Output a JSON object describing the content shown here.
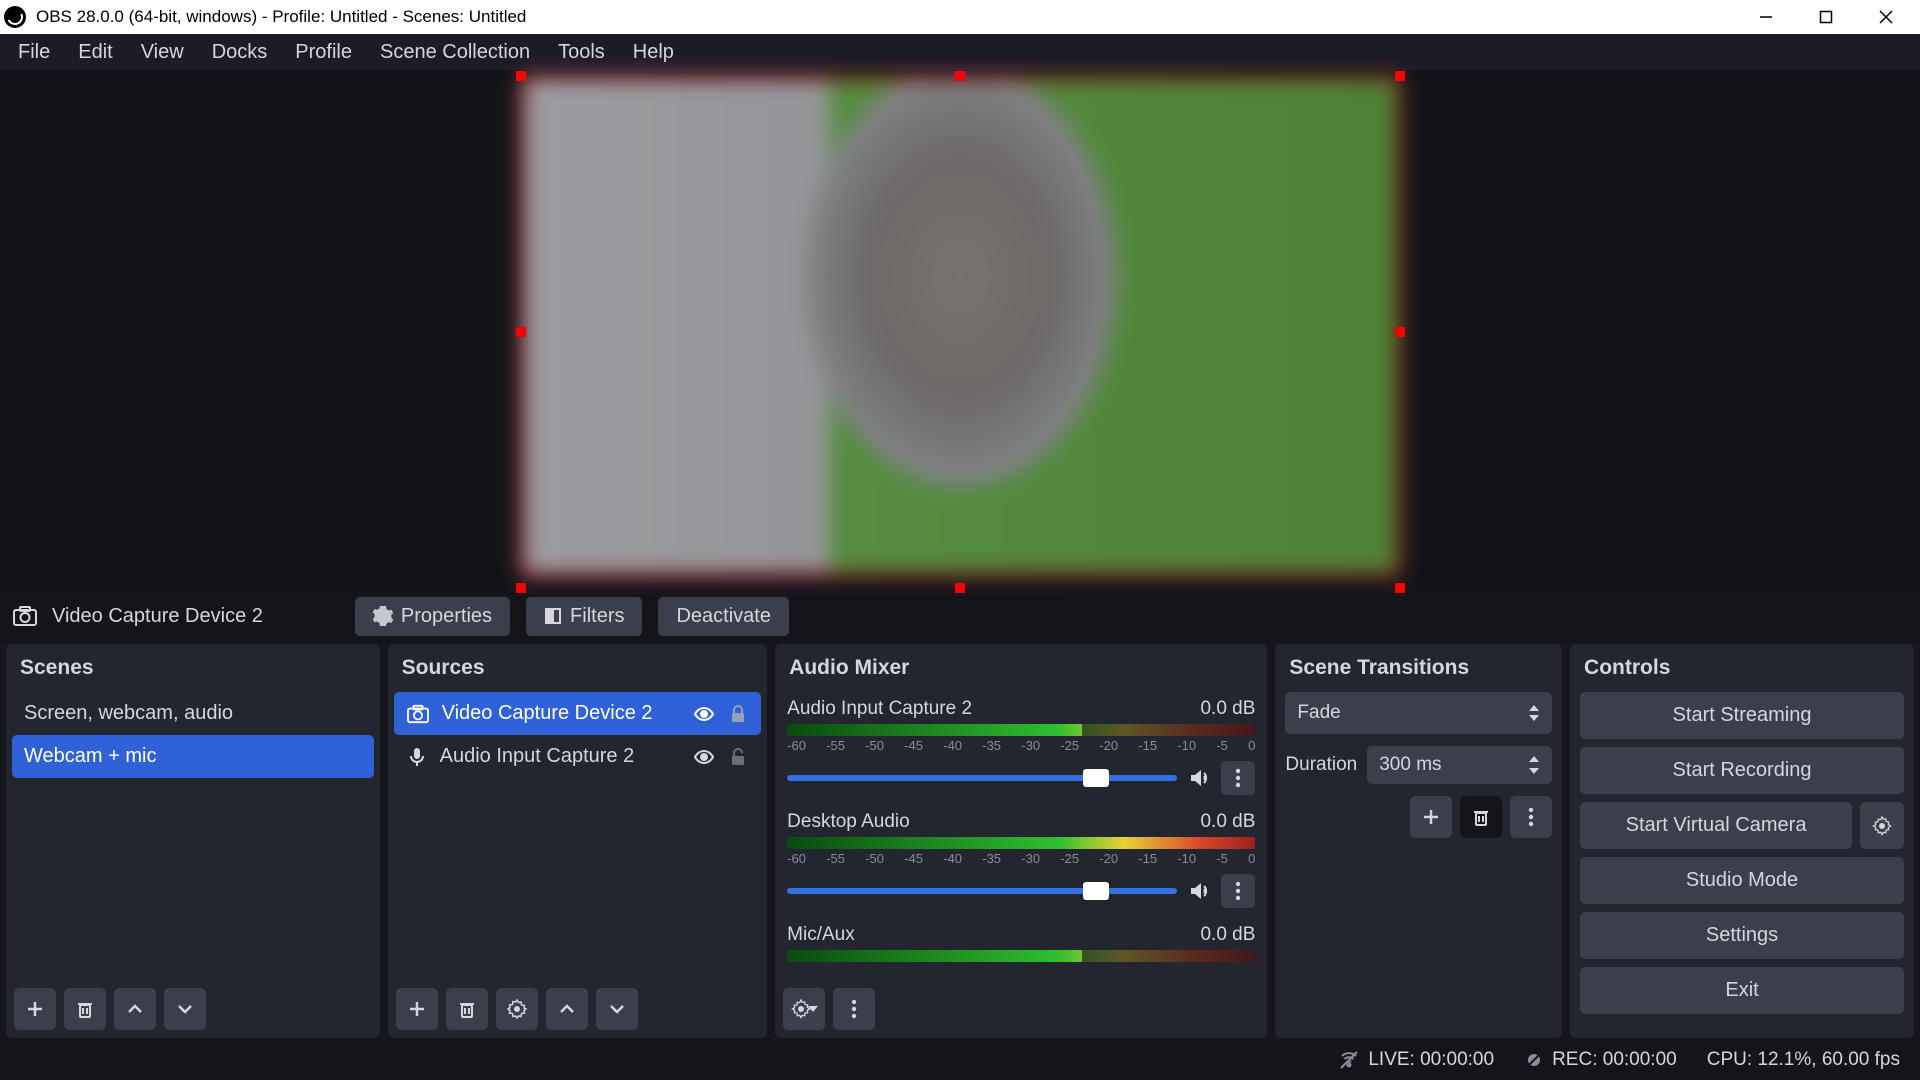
{
  "title": "OBS 28.0.0 (64-bit, windows) - Profile: Untitled - Scenes: Untitled",
  "menu": {
    "items": [
      "File",
      "Edit",
      "View",
      "Docks",
      "Profile",
      "Scene Collection",
      "Tools",
      "Help"
    ]
  },
  "selected_source": {
    "name": "Video Capture Device 2",
    "btn_properties": "Properties",
    "btn_filters": "Filters",
    "btn_deactivate": "Deactivate"
  },
  "docks": {
    "scenes": {
      "title": "Scenes",
      "items": [
        "Screen, webcam, audio",
        "Webcam + mic"
      ],
      "selected": 1
    },
    "sources": {
      "title": "Sources",
      "items": [
        {
          "icon": "camera",
          "label": "Video Capture Device 2",
          "selected": true,
          "locked": true
        },
        {
          "icon": "mic",
          "label": "Audio Input Capture 2",
          "selected": false,
          "locked": false
        }
      ]
    },
    "mixer": {
      "title": "Audio Mixer",
      "scale": [
        "-60",
        "-55",
        "-50",
        "-45",
        "-40",
        "-35",
        "-30",
        "-25",
        "-20",
        "-15",
        "-10",
        "-5",
        "0"
      ],
      "tracks": [
        {
          "name": "Audio Input Capture 2",
          "db": "0.0 dB"
        },
        {
          "name": "Desktop Audio",
          "db": "0.0 dB"
        },
        {
          "name": "Mic/Aux",
          "db": "0.0 dB"
        }
      ]
    },
    "transitions": {
      "title": "Scene Transitions",
      "current": "Fade",
      "duration_label": "Duration",
      "duration_value": "300 ms"
    },
    "controls": {
      "title": "Controls",
      "start_streaming": "Start Streaming",
      "start_recording": "Start Recording",
      "start_virtual_camera": "Start Virtual Camera",
      "studio_mode": "Studio Mode",
      "settings": "Settings",
      "exit": "Exit"
    }
  },
  "status": {
    "live": "LIVE: 00:00:00",
    "rec": "REC: 00:00:00",
    "cpu": "CPU: 12.1%, 60.00 fps"
  }
}
